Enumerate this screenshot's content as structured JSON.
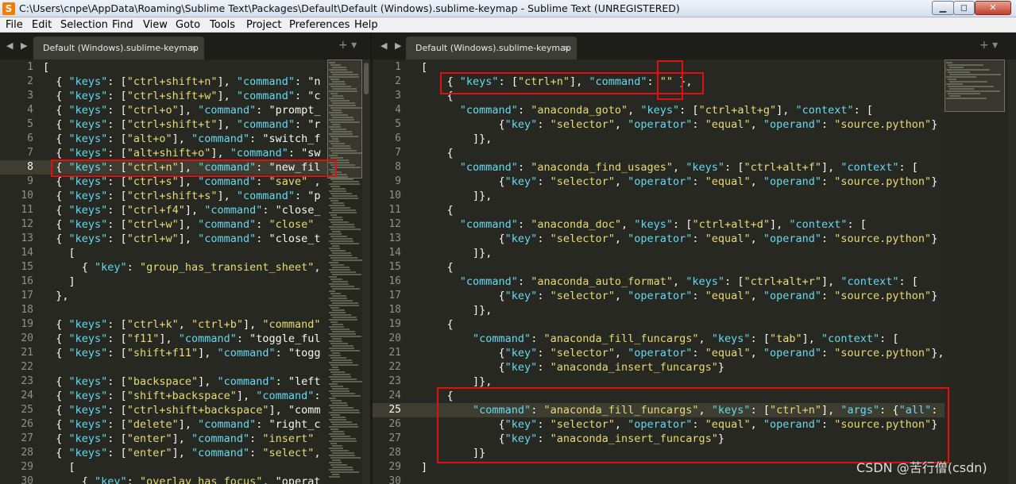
{
  "window": {
    "title": "C:\\Users\\cnpe\\AppData\\Roaming\\Sublime Text\\Packages\\Default\\Default (Windows).sublime-keymap - Sublime Text (UNREGISTERED)",
    "app_icon_glyph": "S",
    "min_glyph": "▁",
    "max_glyph": "◻",
    "close_glyph": "✕"
  },
  "menu": [
    "File",
    "Edit",
    "Selection",
    "Find",
    "View",
    "Goto",
    "Tools",
    "Project",
    "Preferences",
    "Help"
  ],
  "colors": {
    "accent_highlight": "#e01010",
    "editor_bg": "#272822",
    "string": "#e6db74",
    "keyword": "#66d9ef"
  },
  "left_pane": {
    "tab_title": "Default (Windows).sublime-keymap",
    "tab_close": "×",
    "nav": "◀ ▶",
    "tools": "+ ▾",
    "active_line": 8,
    "lines": [
      {
        "n": "1",
        "t": "["
      },
      {
        "n": "2",
        "t": "  { \"keys\": [\"ctrl+shift+n\"], \"command\": \"n"
      },
      {
        "n": "3",
        "t": "  { \"keys\": [\"ctrl+shift+w\"], \"command\": \"c"
      },
      {
        "n": "4",
        "t": "  { \"keys\": [\"ctrl+o\"], \"command\": \"prompt_"
      },
      {
        "n": "5",
        "t": "  { \"keys\": [\"ctrl+shift+t\"], \"command\": \"r"
      },
      {
        "n": "6",
        "t": "  { \"keys\": [\"alt+o\"], \"command\": \"switch_f"
      },
      {
        "n": "7",
        "t": "  { \"keys\": [\"alt+shift+o\"], \"command\": \"sw"
      },
      {
        "n": "8",
        "t": "  { \"keys\": [\"ctrl+n\"], \"command\": \"new_fil"
      },
      {
        "n": "9",
        "t": "  { \"keys\": [\"ctrl+s\"], \"command\": \"save\" ,"
      },
      {
        "n": "10",
        "t": "  { \"keys\": [\"ctrl+shift+s\"], \"command\": \"p"
      },
      {
        "n": "11",
        "t": "  { \"keys\": [\"ctrl+f4\"], \"command\": \"close_"
      },
      {
        "n": "12",
        "t": "  { \"keys\": [\"ctrl+w\"], \"command\": \"close\" "
      },
      {
        "n": "13",
        "t": "  { \"keys\": [\"ctrl+w\"], \"command\": \"close_t"
      },
      {
        "n": "14",
        "t": "    ["
      },
      {
        "n": "15",
        "t": "      { \"key\": \"group_has_transient_sheet\","
      },
      {
        "n": "16",
        "t": "    ]"
      },
      {
        "n": "17",
        "t": "  },"
      },
      {
        "n": "18",
        "t": ""
      },
      {
        "n": "19",
        "t": "  { \"keys\": [\"ctrl+k\", \"ctrl+b\"], \"command\""
      },
      {
        "n": "20",
        "t": "  { \"keys\": [\"f11\"], \"command\": \"toggle_ful"
      },
      {
        "n": "21",
        "t": "  { \"keys\": [\"shift+f11\"], \"command\": \"togg"
      },
      {
        "n": "22",
        "t": ""
      },
      {
        "n": "23",
        "t": "  { \"keys\": [\"backspace\"], \"command\": \"left"
      },
      {
        "n": "24",
        "t": "  { \"keys\": [\"shift+backspace\"], \"command\":"
      },
      {
        "n": "25",
        "t": "  { \"keys\": [\"ctrl+shift+backspace\"], \"comm"
      },
      {
        "n": "26",
        "t": "  { \"keys\": [\"delete\"], \"command\": \"right_c"
      },
      {
        "n": "27",
        "t": "  { \"keys\": [\"enter\"], \"command\": \"insert\""
      },
      {
        "n": "28",
        "t": "  { \"keys\": [\"enter\"], \"command\": \"select\","
      },
      {
        "n": "29",
        "t": "    ["
      },
      {
        "n": "30",
        "t": "      { \"key\": \"overlay_has_focus\", \"operat"
      }
    ]
  },
  "right_pane": {
    "tab_title": "Default (Windows).sublime-keymap",
    "tab_close": "×",
    "nav": "◀ ▶",
    "tools": "+ ▾",
    "active_line": 25,
    "lines": [
      {
        "n": "1",
        "t": "["
      },
      {
        "n": "2",
        "t": "    { \"keys\": [\"ctrl+n\"], \"command\": \"\" },"
      },
      {
        "n": "3",
        "t": "    {"
      },
      {
        "n": "4",
        "t": "      \"command\": \"anaconda_goto\", \"keys\": [\"ctrl+alt+g\"], \"context\": ["
      },
      {
        "n": "5",
        "t": "            {\"key\": \"selector\", \"operator\": \"equal\", \"operand\": \"source.python\"}"
      },
      {
        "n": "6",
        "t": "        ]},"
      },
      {
        "n": "7",
        "t": "    {"
      },
      {
        "n": "8",
        "t": "      \"command\": \"anaconda_find_usages\", \"keys\": [\"ctrl+alt+f\"], \"context\": ["
      },
      {
        "n": "9",
        "t": "            {\"key\": \"selector\", \"operator\": \"equal\", \"operand\": \"source.python\"}"
      },
      {
        "n": "10",
        "t": "        ]},"
      },
      {
        "n": "11",
        "t": "    {"
      },
      {
        "n": "12",
        "t": "      \"command\": \"anaconda_doc\", \"keys\": [\"ctrl+alt+d\"], \"context\": ["
      },
      {
        "n": "13",
        "t": "            {\"key\": \"selector\", \"operator\": \"equal\", \"operand\": \"source.python\"}"
      },
      {
        "n": "14",
        "t": "        ]},"
      },
      {
        "n": "15",
        "t": "    {"
      },
      {
        "n": "16",
        "t": "      \"command\": \"anaconda_auto_format\", \"keys\": [\"ctrl+alt+r\"], \"context\": ["
      },
      {
        "n": "17",
        "t": "            {\"key\": \"selector\", \"operator\": \"equal\", \"operand\": \"source.python\"}"
      },
      {
        "n": "18",
        "t": "        ]},"
      },
      {
        "n": "19",
        "t": "    {"
      },
      {
        "n": "20",
        "t": "        \"command\": \"anaconda_fill_funcargs\", \"keys\": [\"tab\"], \"context\": ["
      },
      {
        "n": "21",
        "t": "            {\"key\": \"selector\", \"operator\": \"equal\", \"operand\": \"source.python\"},"
      },
      {
        "n": "22",
        "t": "            {\"key\": \"anaconda_insert_funcargs\"}"
      },
      {
        "n": "23",
        "t": "        ]},"
      },
      {
        "n": "24",
        "t": "    {"
      },
      {
        "n": "25",
        "t": "        \"command\": \"anaconda_fill_funcargs\", \"keys\": [\"ctrl+n\"], \"args\": {\"all\":"
      },
      {
        "n": "26",
        "t": "            {\"key\": \"selector\", \"operator\": \"equal\", \"operand\": \"source.python\"}"
      },
      {
        "n": "27",
        "t": "            {\"key\": \"anaconda_insert_funcargs\"}"
      },
      {
        "n": "28",
        "t": "        ]}"
      },
      {
        "n": "29",
        "t": "]"
      },
      {
        "n": "30",
        "t": ""
      }
    ]
  },
  "watermark": "CSDN @苦行僧(csdn)"
}
